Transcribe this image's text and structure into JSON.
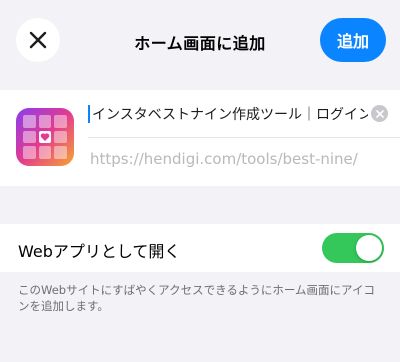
{
  "header": {
    "title": "ホーム画面に追加",
    "add_label": "追加",
    "close_icon": "close-icon"
  },
  "card": {
    "app_icon": "best-nine-grid-icon",
    "name_value": "インスタベストナイン作成ツール｜ログイン不要",
    "url": "https://hendigi.com/tools/best-nine/"
  },
  "webapp": {
    "label": "Webアプリとして開く",
    "enabled": true
  },
  "footnote": "このWebサイトにすばやくアクセスできるようにホーム画面にアイコンを追加します。",
  "colors": {
    "accent": "#0a84ff",
    "toggle_on": "#34c759",
    "background": "#f2f2f7"
  }
}
